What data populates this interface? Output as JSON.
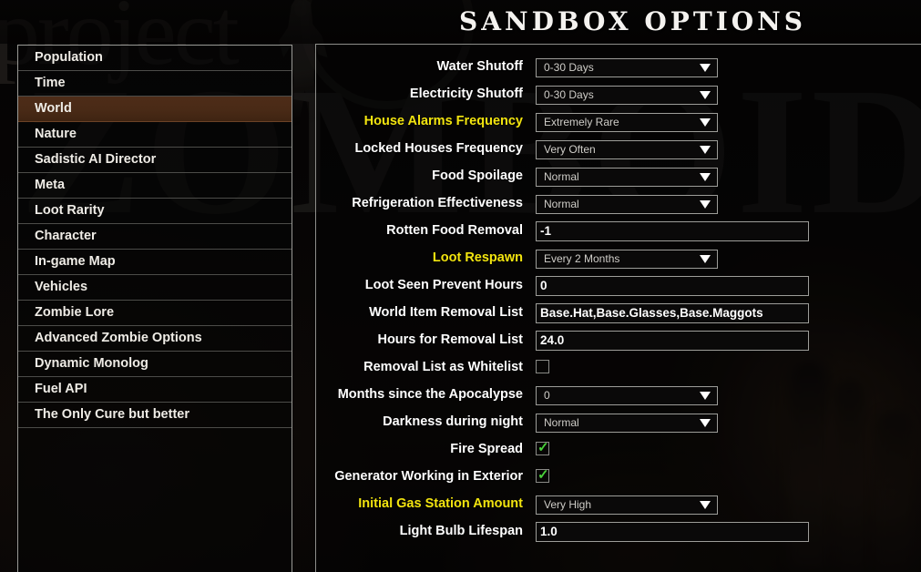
{
  "header": {
    "title": "SANDBOX OPTIONS"
  },
  "watermark": {
    "line1": "project",
    "line2": "ZOMBOID"
  },
  "sidebar": {
    "items": [
      {
        "label": "Population",
        "selected": false
      },
      {
        "label": "Time",
        "selected": false
      },
      {
        "label": "World",
        "selected": true
      },
      {
        "label": "Nature",
        "selected": false
      },
      {
        "label": "Sadistic AI Director",
        "selected": false
      },
      {
        "label": "Meta",
        "selected": false
      },
      {
        "label": "Loot Rarity",
        "selected": false
      },
      {
        "label": "Character",
        "selected": false
      },
      {
        "label": "In-game Map",
        "selected": false
      },
      {
        "label": "Vehicles",
        "selected": false
      },
      {
        "label": "Zombie Lore",
        "selected": false
      },
      {
        "label": "Advanced Zombie Options",
        "selected": false
      },
      {
        "label": "Dynamic Monolog",
        "selected": false
      },
      {
        "label": "Fuel API",
        "selected": false
      },
      {
        "label": "The Only Cure but better",
        "selected": false
      }
    ]
  },
  "colors": {
    "highlight_label": "#f2e40f",
    "selected_row": "#492a16",
    "check_green": "#49d13a",
    "panel_border": "#9a9a96"
  },
  "options": [
    {
      "label": "Water Shutoff",
      "highlight": false,
      "type": "combo",
      "value": "0-30 Days"
    },
    {
      "label": "Electricity Shutoff",
      "highlight": false,
      "type": "combo",
      "value": "0-30 Days"
    },
    {
      "label": "House Alarms Frequency",
      "highlight": true,
      "type": "combo",
      "value": "Extremely Rare"
    },
    {
      "label": "Locked Houses Frequency",
      "highlight": false,
      "type": "combo",
      "value": "Very Often"
    },
    {
      "label": "Food Spoilage",
      "highlight": false,
      "type": "combo",
      "value": "Normal"
    },
    {
      "label": "Refrigeration Effectiveness",
      "highlight": false,
      "type": "combo",
      "value": "Normal"
    },
    {
      "label": "Rotten Food Removal",
      "highlight": false,
      "type": "entry",
      "value": "-1"
    },
    {
      "label": "Loot Respawn",
      "highlight": true,
      "type": "combo",
      "value": "Every 2 Months"
    },
    {
      "label": "Loot Seen Prevent Hours",
      "highlight": false,
      "type": "entry",
      "value": "0"
    },
    {
      "label": "World Item Removal List",
      "highlight": false,
      "type": "entry",
      "value": "Base.Hat,Base.Glasses,Base.Maggots"
    },
    {
      "label": "Hours for Removal List",
      "highlight": false,
      "type": "entry",
      "value": "24.0"
    },
    {
      "label": "Removal List as Whitelist",
      "highlight": false,
      "type": "checkbox",
      "checked": false
    },
    {
      "label": "Months since the Apocalypse",
      "highlight": false,
      "type": "combo",
      "value": "0"
    },
    {
      "label": "Darkness during night",
      "highlight": false,
      "type": "combo",
      "value": "Normal"
    },
    {
      "label": "Fire Spread",
      "highlight": false,
      "type": "checkbox",
      "checked": true
    },
    {
      "label": "Generator Working in Exterior",
      "highlight": false,
      "type": "checkbox",
      "checked": true
    },
    {
      "label": "Initial Gas Station Amount",
      "highlight": true,
      "type": "combo",
      "value": "Very High"
    },
    {
      "label": "Light Bulb Lifespan",
      "highlight": false,
      "type": "entry",
      "value": "1.0"
    }
  ]
}
